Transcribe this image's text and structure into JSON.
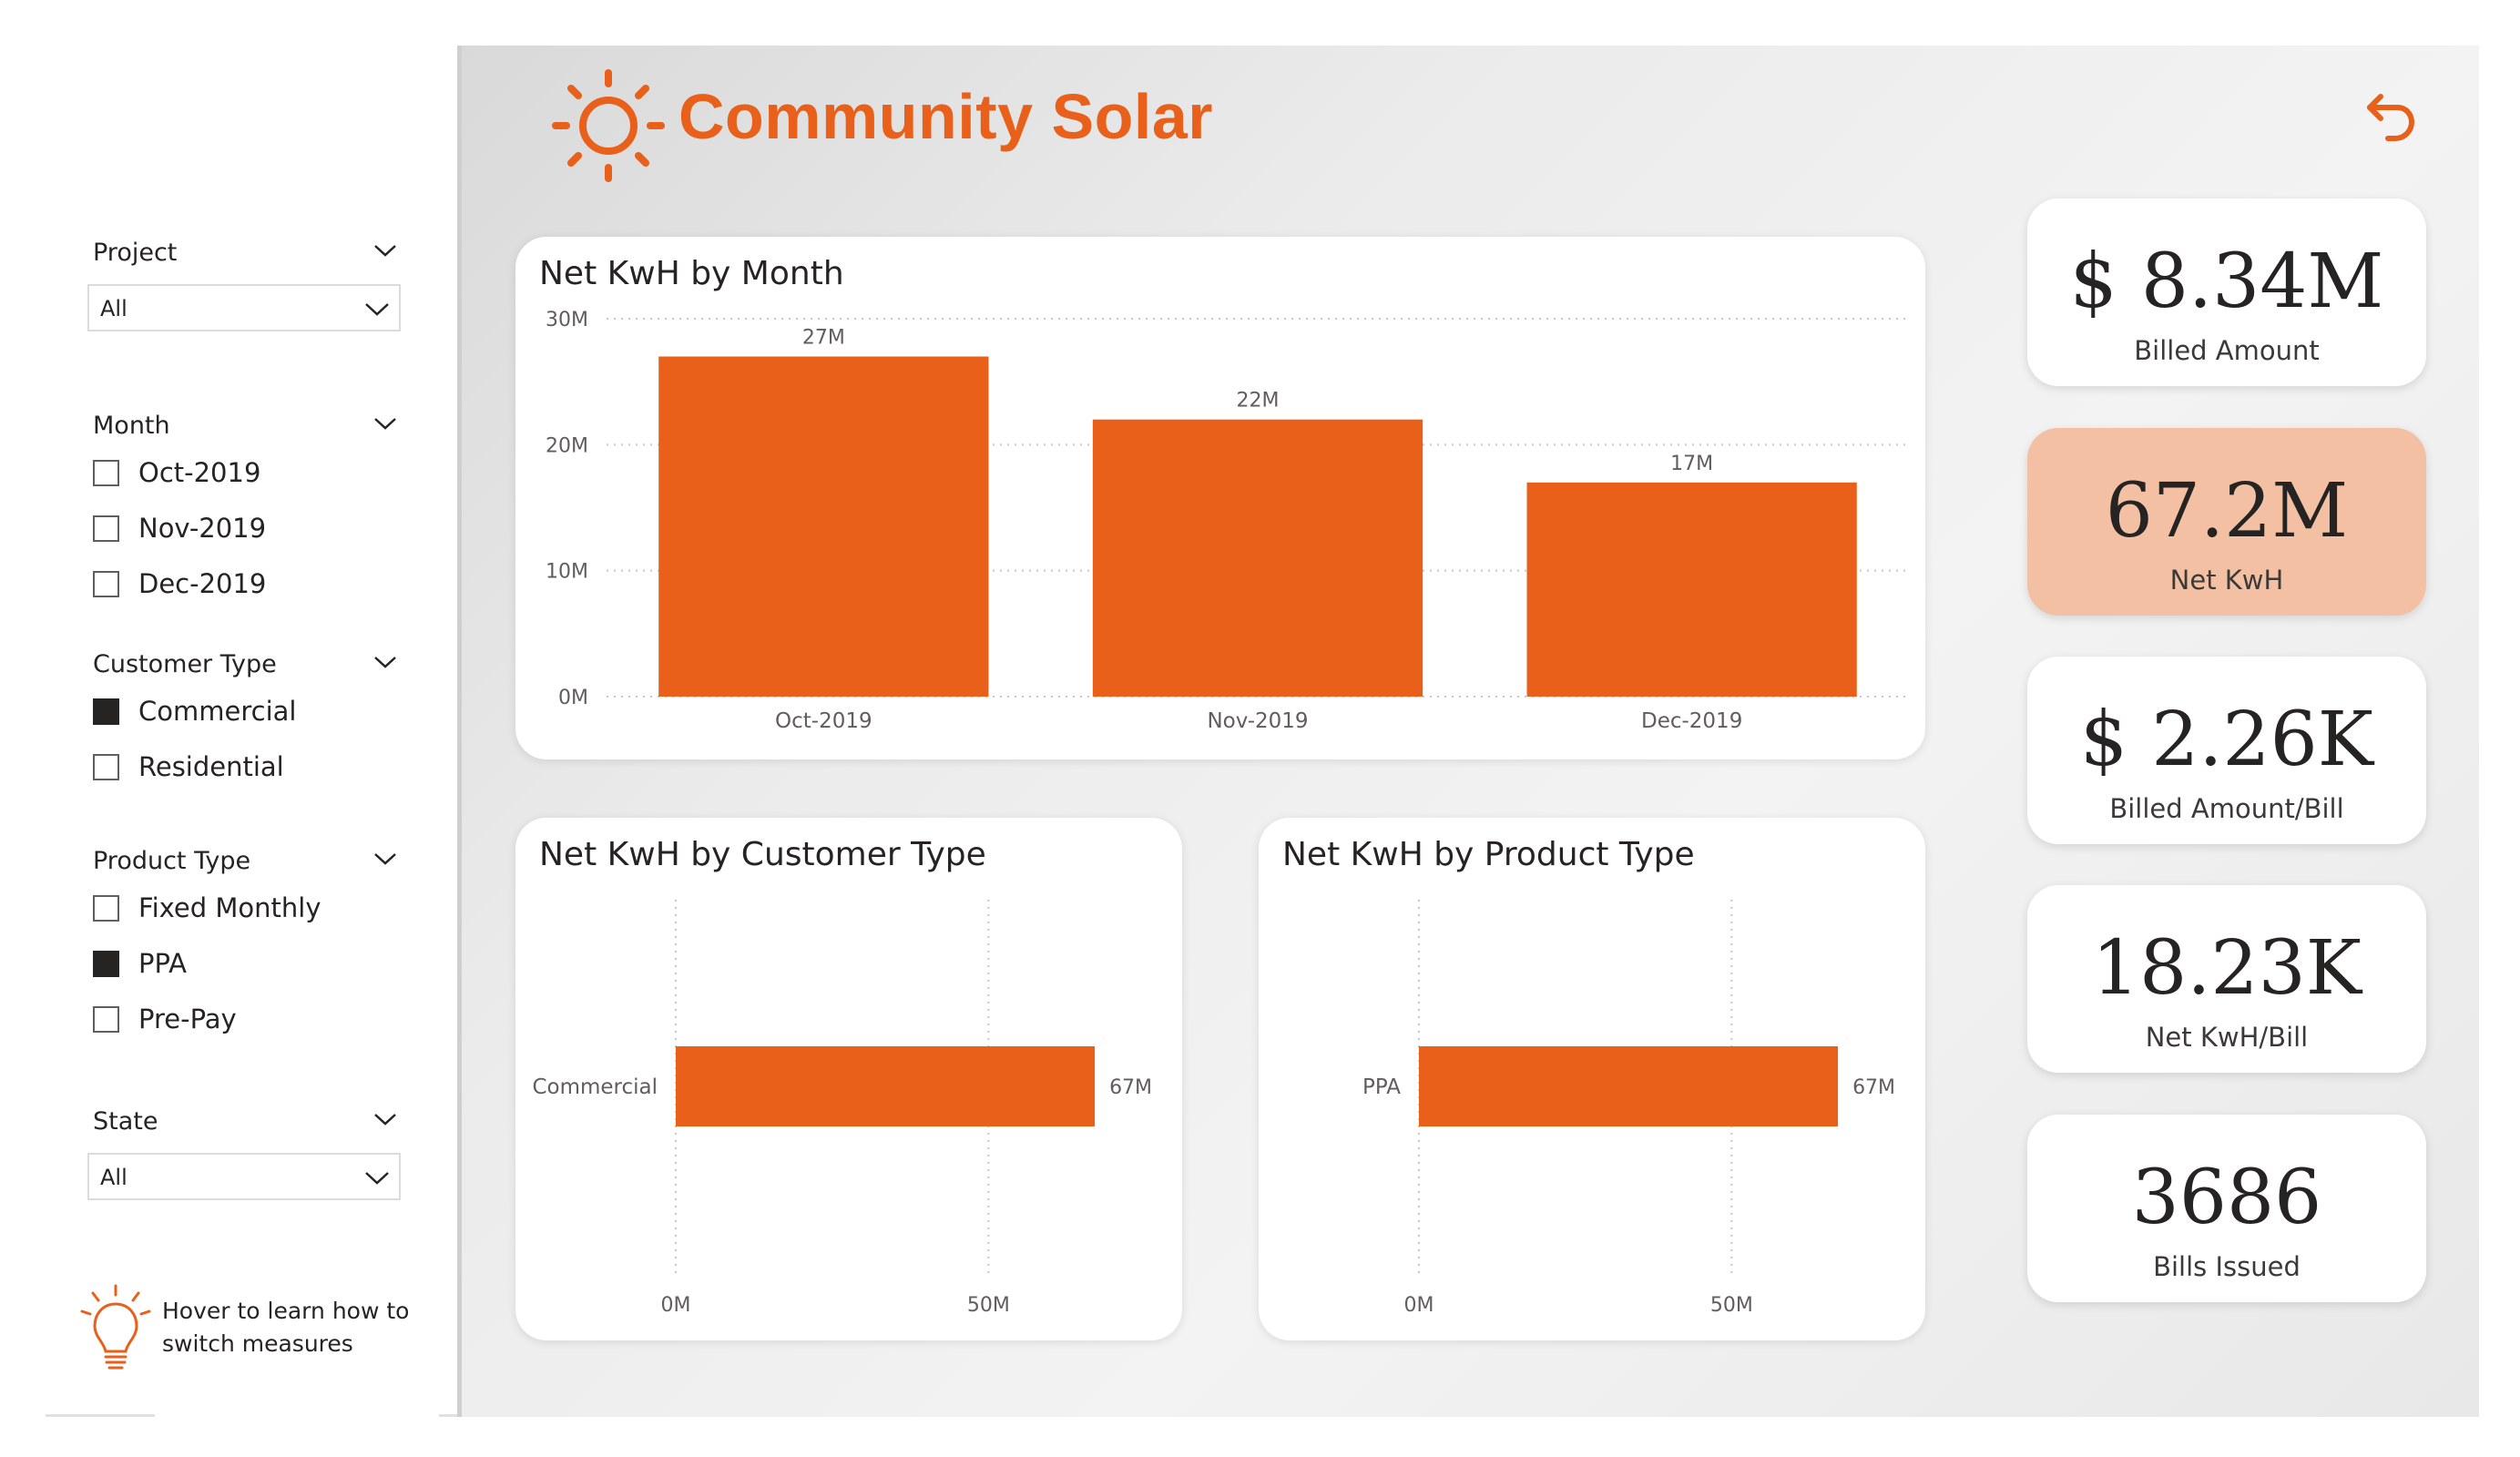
{
  "app": {
    "title": "Community Solar"
  },
  "slicers": {
    "project": {
      "title": "Project",
      "selected": "All"
    },
    "month": {
      "title": "Month",
      "options": [
        {
          "label": "Oct-2019",
          "checked": false
        },
        {
          "label": "Nov-2019",
          "checked": false
        },
        {
          "label": "Dec-2019",
          "checked": false
        }
      ]
    },
    "customer_type": {
      "title": "Customer Type",
      "options": [
        {
          "label": "Commercial",
          "checked": true
        },
        {
          "label": "Residential",
          "checked": false
        }
      ]
    },
    "product_type": {
      "title": "Product Type",
      "options": [
        {
          "label": "Fixed Monthly",
          "checked": false
        },
        {
          "label": "PPA",
          "checked": true
        },
        {
          "label": "Pre-Pay",
          "checked": false
        }
      ]
    },
    "state": {
      "title": "State",
      "selected": "All"
    }
  },
  "hint": {
    "text": "Hover to learn how to switch measures"
  },
  "kpis": [
    {
      "value": "$ 8.34M",
      "label": "Billed Amount",
      "highlight": false
    },
    {
      "value": "67.2M",
      "label": "Net KwH",
      "highlight": true
    },
    {
      "value": "$ 2.26K",
      "label": "Billed Amount/Bill",
      "highlight": false
    },
    {
      "value": "18.23K",
      "label": "Net KwH/Bill",
      "highlight": false
    },
    {
      "value": "3686",
      "label": "Bills Issued",
      "highlight": false
    }
  ],
  "colors": {
    "accent": "#e8601a",
    "kpi_highlight": "#f4c0a3"
  },
  "icons": {
    "logo": "sun-icon",
    "back": "back-arrow-icon",
    "hint": "lightbulb-icon",
    "dropdown": "chevron-down-icon"
  },
  "chart_data": [
    {
      "type": "bar",
      "title": "Net KwH by Month",
      "categories": [
        "Oct-2019",
        "Nov-2019",
        "Dec-2019"
      ],
      "values": [
        27,
        22,
        17
      ],
      "data_labels": [
        "27M",
        "22M",
        "17M"
      ],
      "ylim": [
        0,
        30
      ],
      "yticks": [
        "0M",
        "10M",
        "20M",
        "30M"
      ],
      "grid": true
    },
    {
      "type": "bar",
      "orientation": "horizontal",
      "title": "Net KwH by Customer Type",
      "categories": [
        "Commercial"
      ],
      "values": [
        67
      ],
      "data_labels": [
        "67M"
      ],
      "xlim": [
        0,
        75
      ],
      "xticks": [
        "0M",
        "50M"
      ],
      "grid": true
    },
    {
      "type": "bar",
      "orientation": "horizontal",
      "title": "Net KwH by Product Type",
      "categories": [
        "PPA"
      ],
      "values": [
        67
      ],
      "data_labels": [
        "67M"
      ],
      "xlim": [
        0,
        75
      ],
      "xticks": [
        "0M",
        "50M"
      ],
      "grid": true
    }
  ]
}
